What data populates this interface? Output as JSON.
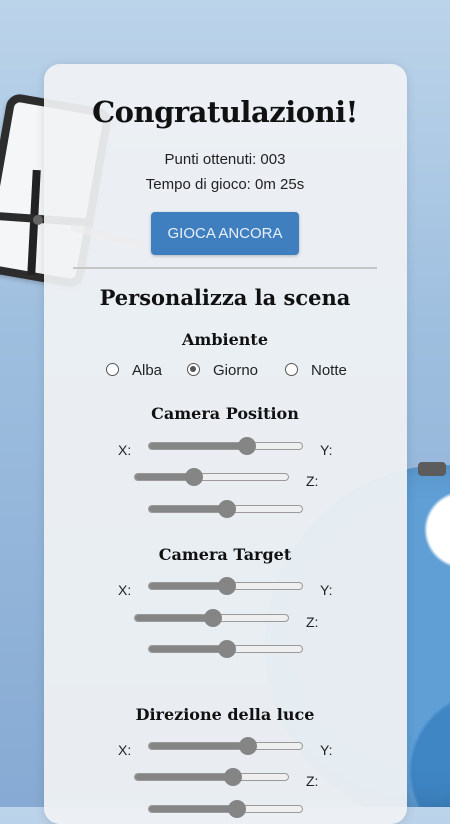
{
  "end_screen": {
    "title": "Congratulazioni!",
    "score_text": "Punti ottenuti: 003",
    "time_text": "Tempo di gioco: 0m 25s",
    "play_again_label": "GIOCA ANCORA"
  },
  "customize": {
    "heading": "Personalizza la scena",
    "ambient": {
      "heading": "Ambiente",
      "options": [
        "Alba",
        "Giorno",
        "Notte"
      ],
      "selected": "Giorno"
    },
    "camera_position": {
      "heading": "Camera Position",
      "labels": {
        "x": "X:",
        "y": "Y:",
        "z": "Z:"
      },
      "values": {
        "x": 0.63,
        "y": 0.38,
        "z": 0.5
      }
    },
    "camera_target": {
      "heading": "Camera Target",
      "labels": {
        "x": "X:",
        "y": "Y:",
        "z": "Z:"
      },
      "values": {
        "x": 0.5,
        "y": 0.5,
        "z": 0.5
      }
    },
    "light_direction": {
      "heading": "Direzione della luce",
      "labels": {
        "x": "X:",
        "y": "Y:",
        "z": "Z:"
      },
      "values": {
        "x": 0.64,
        "y": 0.63,
        "z": 0.57
      }
    }
  },
  "colors": {
    "button": "#3f7fbf",
    "slider": "#858585"
  }
}
